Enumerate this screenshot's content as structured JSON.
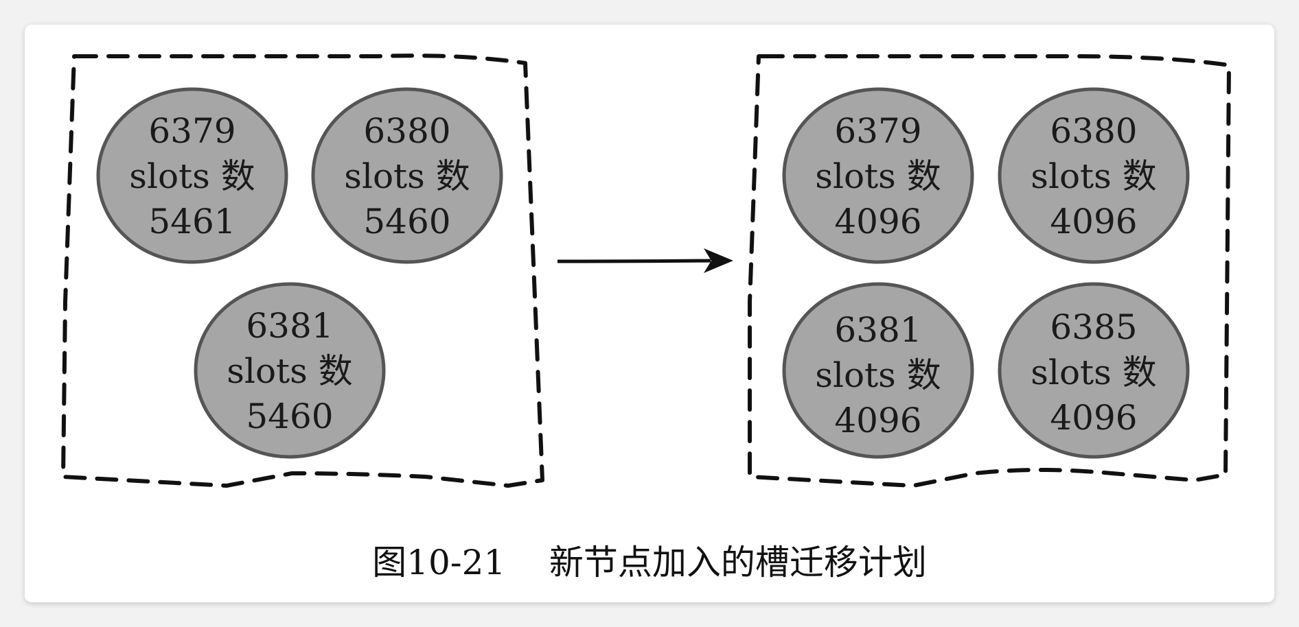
{
  "diagram": {
    "caption": "图10-21    新节点加入的槽迁移计划",
    "before": {
      "nodes": [
        {
          "port": "6379",
          "label": "slots 数",
          "slots": "5461"
        },
        {
          "port": "6380",
          "label": "slots 数",
          "slots": "5460"
        },
        {
          "port": "6381",
          "label": "slots 数",
          "slots": "5460"
        }
      ]
    },
    "after": {
      "nodes": [
        {
          "port": "6379",
          "label": "slots 数",
          "slots": "4096"
        },
        {
          "port": "6380",
          "label": "slots 数",
          "slots": "4096"
        },
        {
          "port": "6381",
          "label": "slots 数",
          "slots": "4096"
        },
        {
          "port": "6385",
          "label": "slots 数",
          "slots": "4096"
        }
      ]
    },
    "colors": {
      "node_fill": "#a6a6a6",
      "node_stroke": "#555555",
      "border": "#111111"
    }
  }
}
